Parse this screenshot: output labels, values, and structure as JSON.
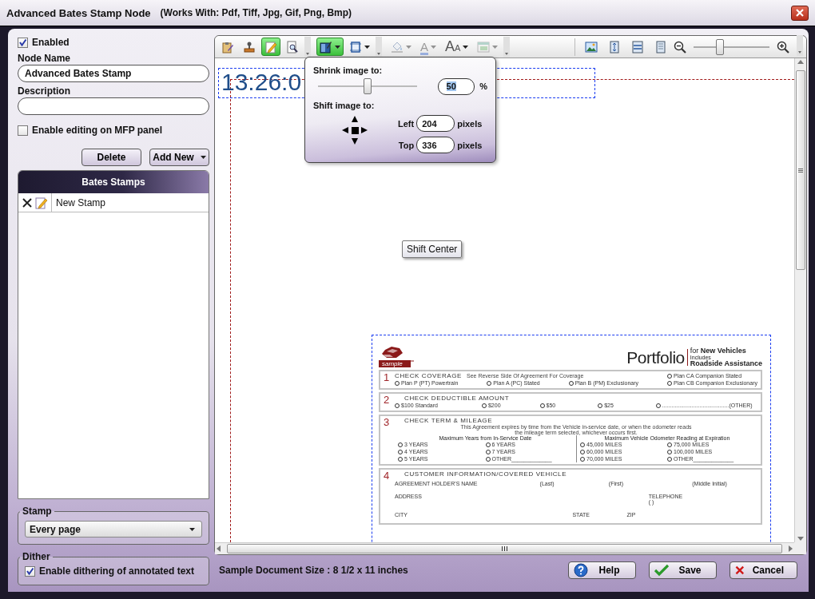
{
  "window": {
    "title": "Advanced Bates Stamp Node",
    "subtitle": "(Works With: Pdf, Tiff, Jpg, Gif, Png, Bmp)"
  },
  "settings": {
    "enabled": {
      "label": "Enabled",
      "checked": true
    },
    "node_name": {
      "label": "Node Name",
      "value": "Advanced Bates Stamp"
    },
    "description": {
      "label": "Description"
    },
    "mfp_editing": {
      "label": "Enable editing on MFP panel",
      "checked": false
    }
  },
  "list_buttons": [
    {
      "label": "Delete",
      "kind": "button"
    },
    {
      "label": "Add New",
      "kind": "dropdown"
    }
  ],
  "bates_stamps": {
    "title": "Bates Stamps",
    "items": [
      {
        "name": "New Stamp"
      }
    ]
  },
  "stamp": {
    "legend": "Stamp",
    "value": "Every page"
  },
  "dither": {
    "legend": "Dither",
    "label": "Enable dithering of annotated text",
    "checked": true
  },
  "toolbar": {
    "groups": [
      {
        "tools": [
          {
            "kind": "clipboard",
            "selected": false,
            "disabled": false
          },
          {
            "kind": "stamp",
            "selected": false,
            "disabled": false
          },
          {
            "kind": "pencil",
            "selected": true,
            "disabled": false
          },
          {
            "kind": "preview",
            "selected": false,
            "disabled": false
          }
        ]
      },
      {
        "tools": [
          {
            "kind": "image",
            "selected": true,
            "disabled": false,
            "dropdown": true
          },
          {
            "kind": "frame",
            "selected": false,
            "disabled": false,
            "dropdown": true
          }
        ]
      },
      {
        "tools": [
          {
            "kind": "fill",
            "selected": false,
            "disabled": true,
            "dropdown": true
          },
          {
            "kind": "text-color",
            "glyph": "A",
            "selected": false,
            "disabled": true,
            "dropdown": true
          },
          {
            "kind": "font",
            "glyph": "AA",
            "selected": false,
            "disabled": false,
            "dropdown": true
          },
          {
            "kind": "layout",
            "selected": false,
            "disabled": true,
            "dropdown": true
          }
        ]
      }
    ],
    "view_tools": [
      {
        "kind": "picture"
      },
      {
        "kind": "fit-page"
      },
      {
        "kind": "fit-width"
      },
      {
        "kind": "page"
      }
    ],
    "zoom": {
      "level": 0.35
    }
  },
  "popup": {
    "shrink_label": "Shrink image to:",
    "shrink": {
      "level": 0.5,
      "value": "50",
      "unit": "%",
      "value_selected": true
    },
    "shift_label": "Shift image to:",
    "offsets": [
      {
        "label": "Left",
        "value": "204",
        "unit": "pixels"
      },
      {
        "label": "Top",
        "value": "336",
        "unit": "pixels"
      }
    ]
  },
  "tooltip": "Shift Center",
  "canvas": {
    "stamp_text": "13:26:0",
    "document": {
      "logo_text": "sample",
      "title": "Portfolio",
      "tag_for": "for",
      "tag_main": "New Vehicles",
      "tag_includes": "Includes",
      "tag_extra": "Roadside Assistance",
      "sections": [
        {
          "kind": "plans",
          "number": "1",
          "heading": "CHECK COVERAGE",
          "note": "See Reverse Side Of Agreement For Coverage",
          "options": [
            "Plan CA Companion Stated",
            "Plan P (PT) Powertrain",
            "Plan A (PC) Stated",
            "Plan B (PM) Exclusionary",
            "Plan CB Companion Exclusionary"
          ]
        },
        {
          "kind": "amounts",
          "number": "2",
          "heading": "CHECK DEDUCTIBLE AMOUNT",
          "options": [
            "$100 Standard",
            "$200",
            "$50",
            "$25",
            "...........................................(OTHER)"
          ]
        },
        {
          "kind": "terms",
          "number": "3",
          "heading": "CHECK TERM & MILEAGE",
          "note": "This Agreement expires by time from the Vehicle in-service date, or when the odometer reads the mileage term selected, whichever occurs first.",
          "columns": [
            {
              "title": "Maximum Years from In-Service Date",
              "options": [
                "3 YEARS",
                "6 YEARS",
                "4 YEARS",
                "7 YEARS",
                "5 YEARS",
                "OTHER_____________"
              ]
            },
            {
              "title": "Maximum Vehicle Odometer Reading at Expiration",
              "options": [
                "45,000 MILES",
                "75,000 MILES",
                "60,000 MILES",
                "100,000 MILES",
                "70,000 MILES",
                "OTHER_____________"
              ]
            }
          ]
        },
        {
          "kind": "fields",
          "number": "4",
          "heading": "CUSTOMER INFORMATION/COVERED VEHICLE",
          "field_rows": [
            [
              "AGREEMENT HOLDER'S NAME",
              "(Last)",
              "(First)",
              "(Middle Initial)"
            ],
            [
              "ADDRESS",
              "TELEPHONE"
            ],
            [
              "CITY",
              "STATE",
              "ZIP"
            ]
          ],
          "phone_hint": "(        )"
        }
      ]
    }
  },
  "footer": {
    "doc_size": "Sample Document Size : 8 1/2 x 11 inches",
    "buttons": [
      {
        "label": "Help",
        "kind": "help"
      },
      {
        "label": "Save",
        "kind": "save"
      },
      {
        "label": "Cancel",
        "kind": "cancel"
      }
    ]
  }
}
